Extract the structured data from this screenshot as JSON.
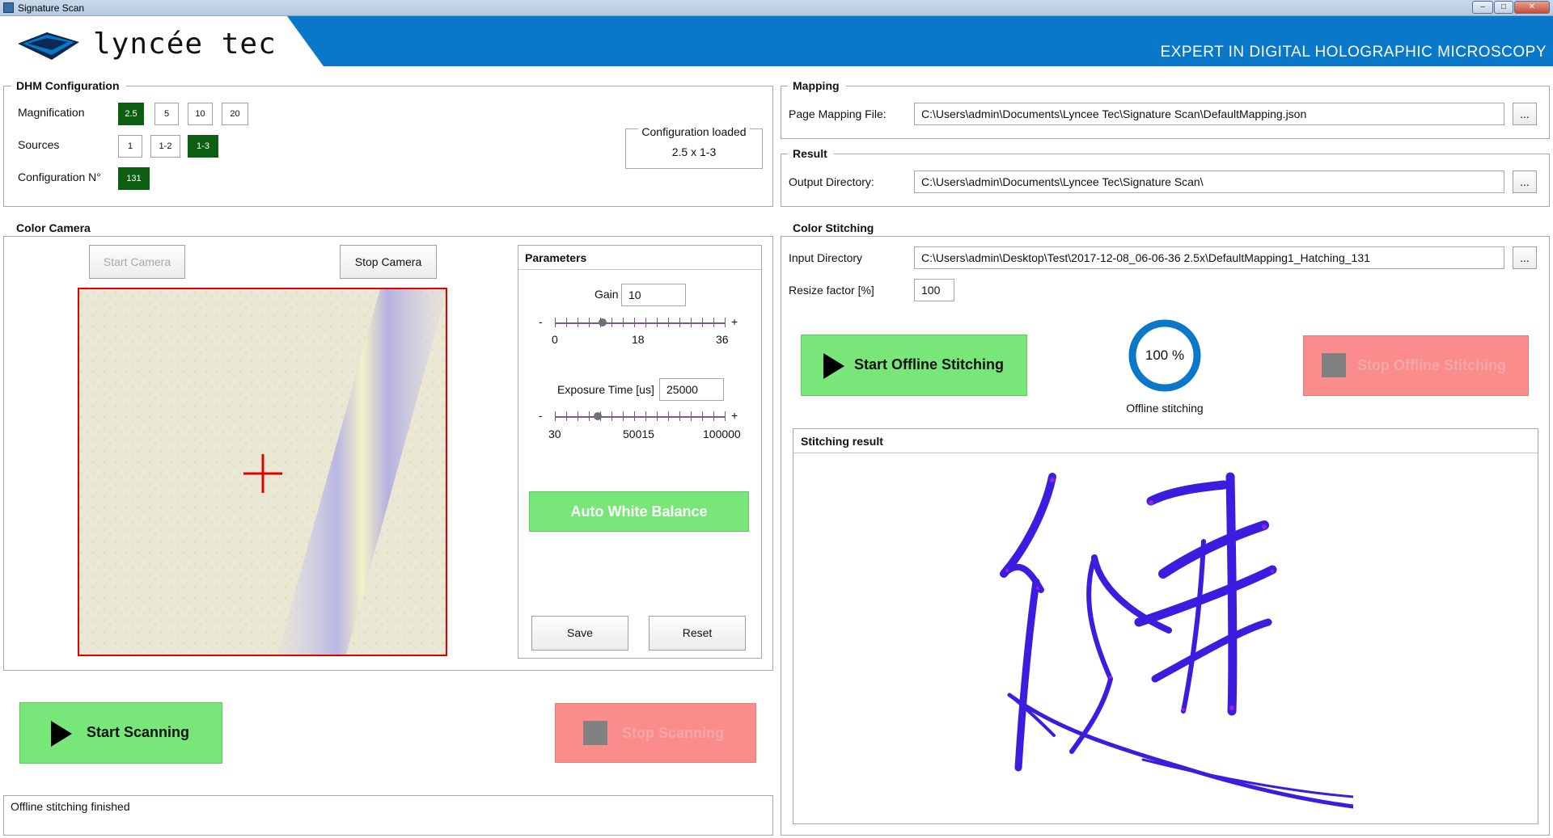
{
  "window": {
    "title": "Signature Scan"
  },
  "header": {
    "brand": "lyncée tec",
    "tagline": "EXPERT IN DIGITAL HOLOGRAPHIC MICROSCOPY",
    "color": "#0a78c8"
  },
  "dhm": {
    "title": "DHM Configuration",
    "magnification_label": "Magnification",
    "magnifications": [
      {
        "label": "2.5",
        "selected": true
      },
      {
        "label": "5",
        "selected": false
      },
      {
        "label": "10",
        "selected": false
      },
      {
        "label": "20",
        "selected": false
      }
    ],
    "sources_label": "Sources",
    "sources": [
      {
        "label": "1",
        "selected": false
      },
      {
        "label": "1-2",
        "selected": false
      },
      {
        "label": "1-3",
        "selected": true
      }
    ],
    "config_label": "Configuration N°",
    "config_value": "131",
    "status_title": "Configuration loaded",
    "status_value": "2.5 x 1-3"
  },
  "mapping": {
    "title": "Mapping",
    "label": "Page Mapping File:",
    "value": "C:\\Users\\admin\\Documents\\Lyncee Tec\\Signature Scan\\DefaultMapping.json",
    "browse": "..."
  },
  "result": {
    "title": "Result",
    "label": "Output Directory:",
    "value": "C:\\Users\\admin\\Documents\\Lyncee Tec\\Signature Scan\\",
    "browse": "..."
  },
  "camera": {
    "title": "Color Camera",
    "start_label": "Start Camera",
    "stop_label": "Stop Camera",
    "params": {
      "title": "Parameters",
      "gain_label": "Gain",
      "gain_value": "10",
      "gain_ticks": [
        "0",
        "18",
        "36"
      ],
      "gain_fraction": 0.28,
      "exposure_label": "Exposure Time [us]",
      "exposure_value": "25000",
      "exposure_ticks": [
        "30",
        "50015",
        "100000"
      ],
      "exposure_fraction": 0.25,
      "minus": "-",
      "plus": "+",
      "awb_label": "Auto White Balance",
      "save_label": "Save",
      "reset_label": "Reset"
    }
  },
  "scan": {
    "start_label": "Start Scanning",
    "stop_label": "Stop Scanning"
  },
  "status_text": "Offline stitching finished",
  "stitching": {
    "title": "Color Stitching",
    "input_label": "Input Directory",
    "input_value": "C:\\Users\\admin\\Desktop\\Test\\2017-12-08_06-06-36 2.5x\\DefaultMapping1_Hatching_131",
    "browse": "...",
    "resize_label": "Resize factor [%]",
    "resize_value": "100",
    "start_label": "Start Offline Stitching",
    "stop_label": "Stop Offline Stitching",
    "progress_text": "100 %",
    "progress_fraction": 1.0,
    "progress_label": "Offline stitching",
    "result_title": "Stitching result"
  },
  "colors": {
    "accent_green": "#0c5e10",
    "button_green": "#78e678",
    "button_red": "#fb8c8c",
    "progress": "#0a78c8",
    "ink": "#3a1ee0"
  }
}
